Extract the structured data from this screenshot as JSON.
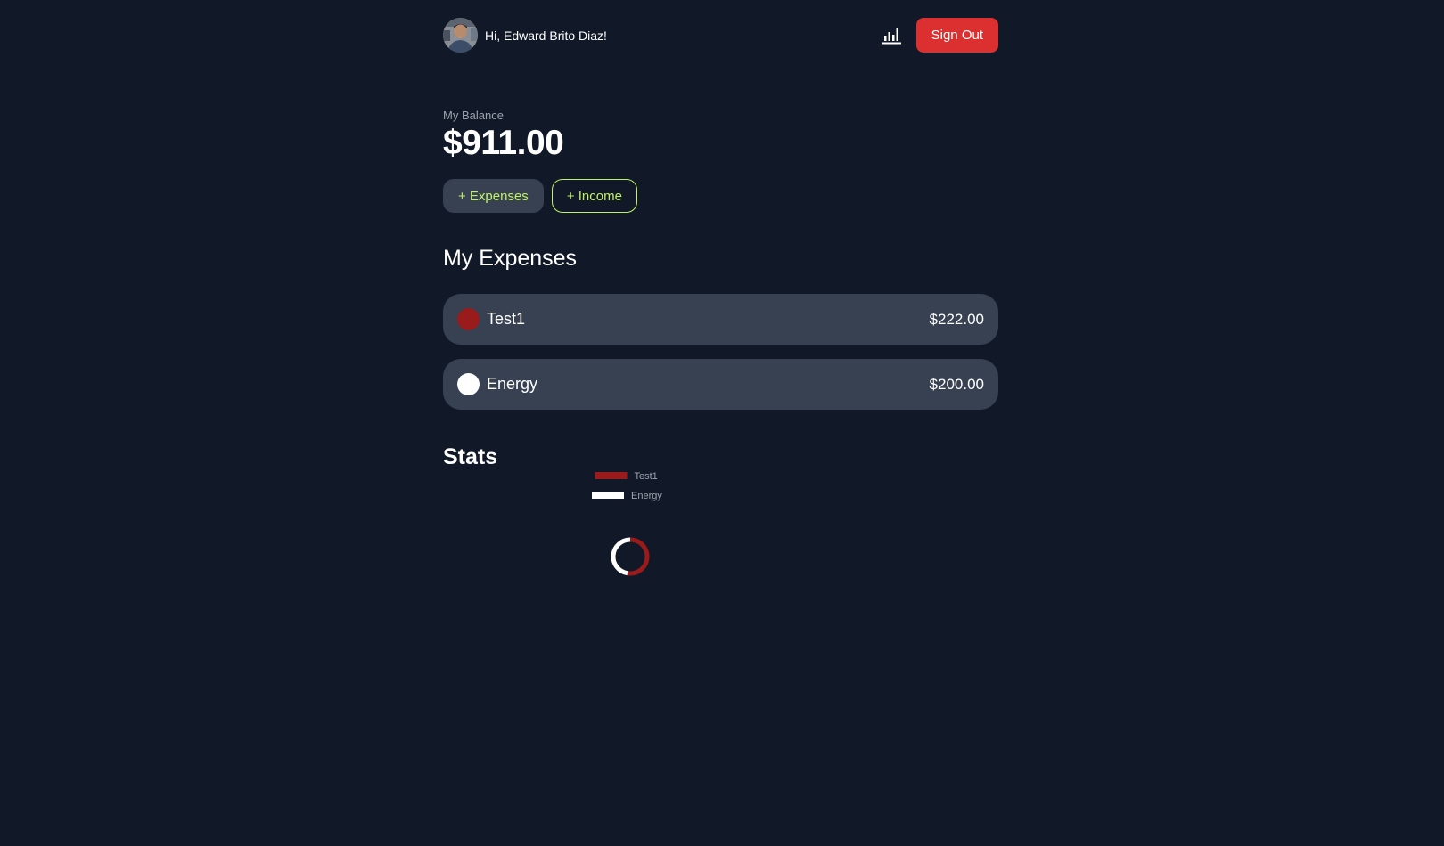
{
  "header": {
    "greeting": "Hi, Edward Brito Diaz!",
    "stats_icon": "bar-chart-icon",
    "signout_label": "Sign Out",
    "signout_color": "#dc2f2f"
  },
  "balance": {
    "label": "My Balance",
    "amount": "$911.00"
  },
  "actions": {
    "expenses_label": "+ Expenses",
    "income_label": "+ Income",
    "accent_color": "#bef264"
  },
  "expenses": {
    "title": "My Expenses",
    "items": [
      {
        "name": "Test1",
        "amount": "$222.00",
        "color": "#991b1b"
      },
      {
        "name": "Energy",
        "amount": "$200.00",
        "color": "#ffffff"
      }
    ]
  },
  "stats": {
    "title": "Stats"
  },
  "chart_data": {
    "type": "pie",
    "variant": "doughnut",
    "categories": [
      "Test1",
      "Energy"
    ],
    "values": [
      222,
      200
    ],
    "colors": [
      "#991b1b",
      "#ffffff"
    ],
    "legend_position": "top",
    "title": ""
  }
}
